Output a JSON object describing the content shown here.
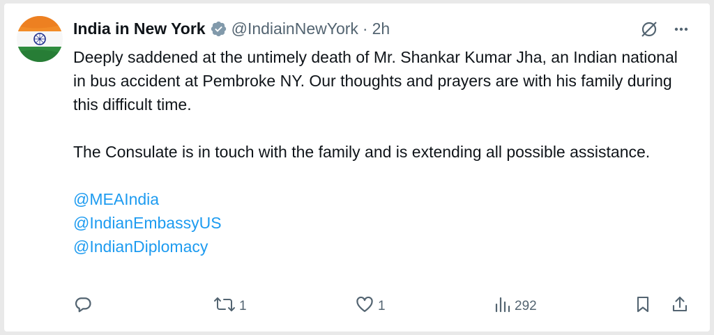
{
  "tweet": {
    "display_name": "India in New York",
    "handle": "@IndiainNewYork",
    "separator": "·",
    "time": "2h",
    "paragraphs": [
      "Deeply saddened at the untimely death of Mr. Shankar Kumar Jha, an Indian national in bus accident at Pembroke NY. Our thoughts and prayers are with his family during this difficult time.",
      "The Consulate is in touch with the family and is extending all possible assistance."
    ],
    "mentions": [
      "@MEAIndia",
      "@IndianEmbassyUS",
      "@IndianDiplomacy"
    ]
  },
  "actions": {
    "reply_count": "",
    "retweet_count": "1",
    "like_count": "1",
    "views_count": "292"
  },
  "colors": {
    "text": "#0f1419",
    "secondary": "#536471",
    "link": "#1d9bf0",
    "verified_badge": "#829aab"
  },
  "icons": {
    "avatar": "india-flag-avatar",
    "verified": "verified-badge-icon",
    "grok": "grok-icon",
    "more": "more-dots-icon",
    "reply": "reply-icon",
    "retweet": "retweet-icon",
    "like": "heart-icon",
    "views": "views-icon",
    "bookmark": "bookmark-icon",
    "share": "share-icon"
  }
}
